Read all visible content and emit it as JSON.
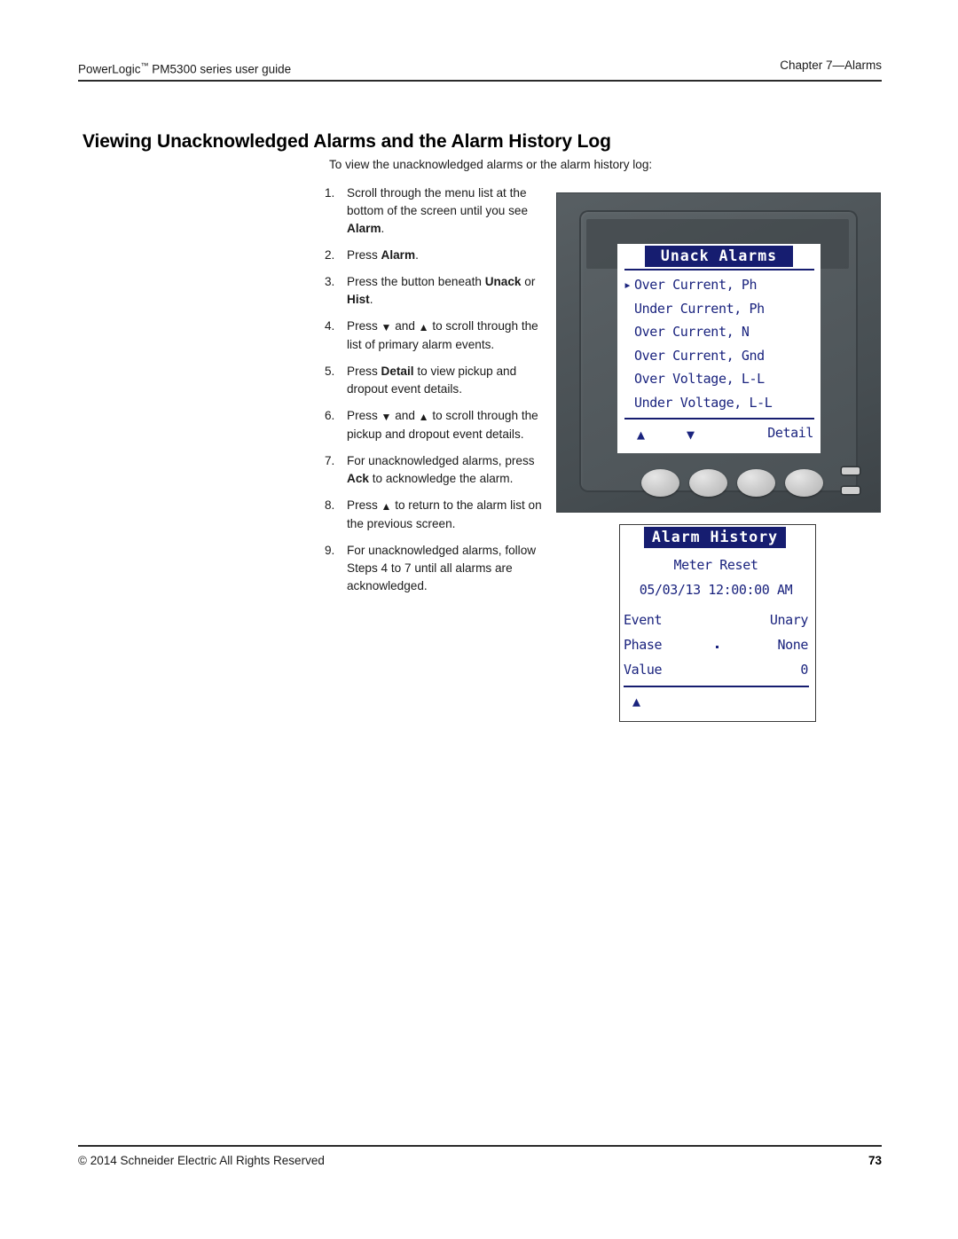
{
  "header": {
    "left_product": "PowerLogic",
    "left_tm": "™",
    "left_rest": " PM5300 series user guide",
    "right": "Chapter 7—Alarms"
  },
  "title": "Viewing Unacknowledged Alarms and the Alarm History Log",
  "intro": "To view the unacknowledged alarms or the alarm history log:",
  "steps": [
    {
      "num": "1.",
      "html": "Scroll through the menu list at the bottom of the screen until you see <b>Alarm</b>."
    },
    {
      "num": "2.",
      "html": "Press <b>Alarm</b>."
    },
    {
      "num": "3.",
      "html": "Press the button beneath <b>Unack</b> or <b>Hist</b>."
    },
    {
      "num": "4.",
      "html": "Press <span class=\"tri tri-down\"></span> and <span class=\"tri tri-up\"></span> to scroll through the list of primary alarm events."
    },
    {
      "num": "5.",
      "html": "Press <b>Detail</b> to view pickup and dropout event details."
    },
    {
      "num": "6.",
      "html": "Press <span class=\"tri tri-down\"></span> and <span class=\"tri tri-up\"></span> to scroll through the pickup and dropout event details."
    },
    {
      "num": "7.",
      "html": "For unacknowledged alarms, press <b>Ack</b> to acknowledge the alarm."
    },
    {
      "num": "8.",
      "html": "Press <span class=\"tri tri-up\"></span> to return to the alarm list on the previous screen."
    },
    {
      "num": "9.",
      "html": "For unacknowledged alarms, follow Steps 4 to 7 until all alarms are acknowledged."
    }
  ],
  "device_screen_1": {
    "title": "Unack Alarms",
    "items": [
      "Over Current, Ph",
      "Under Current, Ph",
      "Over Current, N",
      "Over Current, Gnd",
      "Over Voltage, L-L",
      "Under Voltage, L-L"
    ],
    "selected_index": 0,
    "softkeys": {
      "up": "▲",
      "down": "▼",
      "detail": "Detail"
    }
  },
  "device_screen_2": {
    "title": "Alarm History",
    "event_name": "Meter Reset",
    "timestamp": "05/03/13 12:00:00 AM",
    "rows": [
      {
        "label": "Event",
        "value": "Unary"
      },
      {
        "label": "Phase",
        "value": "None"
      },
      {
        "label": "Value",
        "value": "0"
      }
    ],
    "softkeys": {
      "up": "▲"
    }
  },
  "footer": {
    "left": "© 2014 Schneider Electric All Rights Reserved",
    "page_number": "73"
  },
  "colors": {
    "lcd_blue": "#161d70",
    "lcd_text": "#1a237e",
    "lcd_background": "#ffffff",
    "bezel": "#4e5559",
    "rule": "#2b2b2b"
  }
}
